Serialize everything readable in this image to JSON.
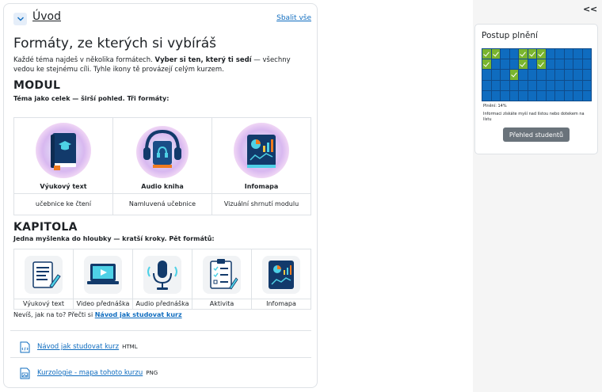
{
  "section": {
    "title": "Úvod",
    "collapse_all": "Sbalit vše"
  },
  "content": {
    "heading": "Formáty, ze kterých si vybíráš",
    "intro_part1": "Každé téma najdeš v několika formátech. ",
    "intro_bold": "Vyber si ten, který ti sedí",
    "intro_part2": " — všechny vedou ke stejnému cíli. Tyhle ikony tě provázejí celým kurzem.",
    "modul": {
      "heading": "MODUL",
      "subheading": "Téma jako celek — širší pohled. Tři formáty:",
      "items": [
        {
          "name": "Výukový text",
          "desc": "učebnice ke čtení",
          "icon": "book-icon"
        },
        {
          "name": "Audio kniha",
          "desc": "Namluvená učebnice",
          "icon": "headphones-book-icon"
        },
        {
          "name": "Infomapa",
          "desc": "Vizuální shrnutí modulu",
          "icon": "infomap-book-icon"
        }
      ]
    },
    "kapitola": {
      "heading": "KAPITOLA",
      "subheading": "Jedna myšlenka do hloubky — kratší kroky. Pět formátů:",
      "items": [
        {
          "name": "Výukový text",
          "icon": "document-pen-icon"
        },
        {
          "name": "Video přednáška",
          "icon": "video-laptop-icon"
        },
        {
          "name": "Audio přednáška",
          "icon": "microphone-icon"
        },
        {
          "name": "Aktivita",
          "icon": "clipboard-checklist-icon"
        },
        {
          "name": "Infomapa",
          "icon": "infomap-tablet-icon"
        }
      ]
    },
    "howto_prefix": "Nevíš, jak na to? Přečti si ",
    "howto_link": "Návod jak studovat kurz"
  },
  "resources": [
    {
      "label": "Návod jak studovat kurz",
      "type": "HTML",
      "icon": "html-file-icon"
    },
    {
      "label": "Kurzologie - mapa tohoto kurzu",
      "type": "PNG",
      "icon": "image-file-icon"
    }
  ],
  "drawer": {
    "toggle": "< <",
    "block_title": "Postup plnění",
    "progress_text": "Plnění: 14%",
    "hint": "Informaci získáte myší nad lístou nebo dotekem na lístu",
    "button": "Přehled studentů",
    "completion_rows": [
      [
        1,
        1,
        0,
        0,
        1,
        1,
        1,
        0,
        0,
        0,
        0,
        0
      ],
      [
        1,
        0,
        0,
        0,
        1,
        0,
        1,
        0,
        0,
        0,
        0,
        0
      ],
      [
        0,
        0,
        0,
        1,
        0,
        0,
        0,
        0,
        0,
        0,
        0,
        0
      ],
      [
        0,
        0,
        0,
        0,
        0,
        0,
        0,
        0,
        0,
        0,
        0,
        0
      ],
      [
        0,
        0,
        0,
        0,
        0,
        0,
        0,
        0,
        0,
        0,
        0,
        0
      ]
    ],
    "colors": {
      "done": "#7ab52f",
      "todo": "#0f6cbf"
    }
  }
}
